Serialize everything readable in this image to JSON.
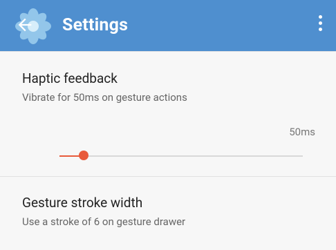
{
  "app": {
    "title": "Settings",
    "colors": {
      "appbar": "#4f8fcf",
      "accent": "#e85a3b"
    },
    "icons": {
      "app_logo": "flower-logo-icon",
      "back": "arrow-left-icon",
      "overflow": "more-vert-icon"
    }
  },
  "settings": {
    "haptic": {
      "title": "Haptic feedback",
      "subtitle": "Vibrate for 50ms on gesture actions",
      "value_label": "50ms",
      "slider_fraction": 0.1
    },
    "stroke_width": {
      "title": "Gesture stroke width",
      "subtitle": "Use a stroke of 6 on gesture drawer"
    }
  }
}
